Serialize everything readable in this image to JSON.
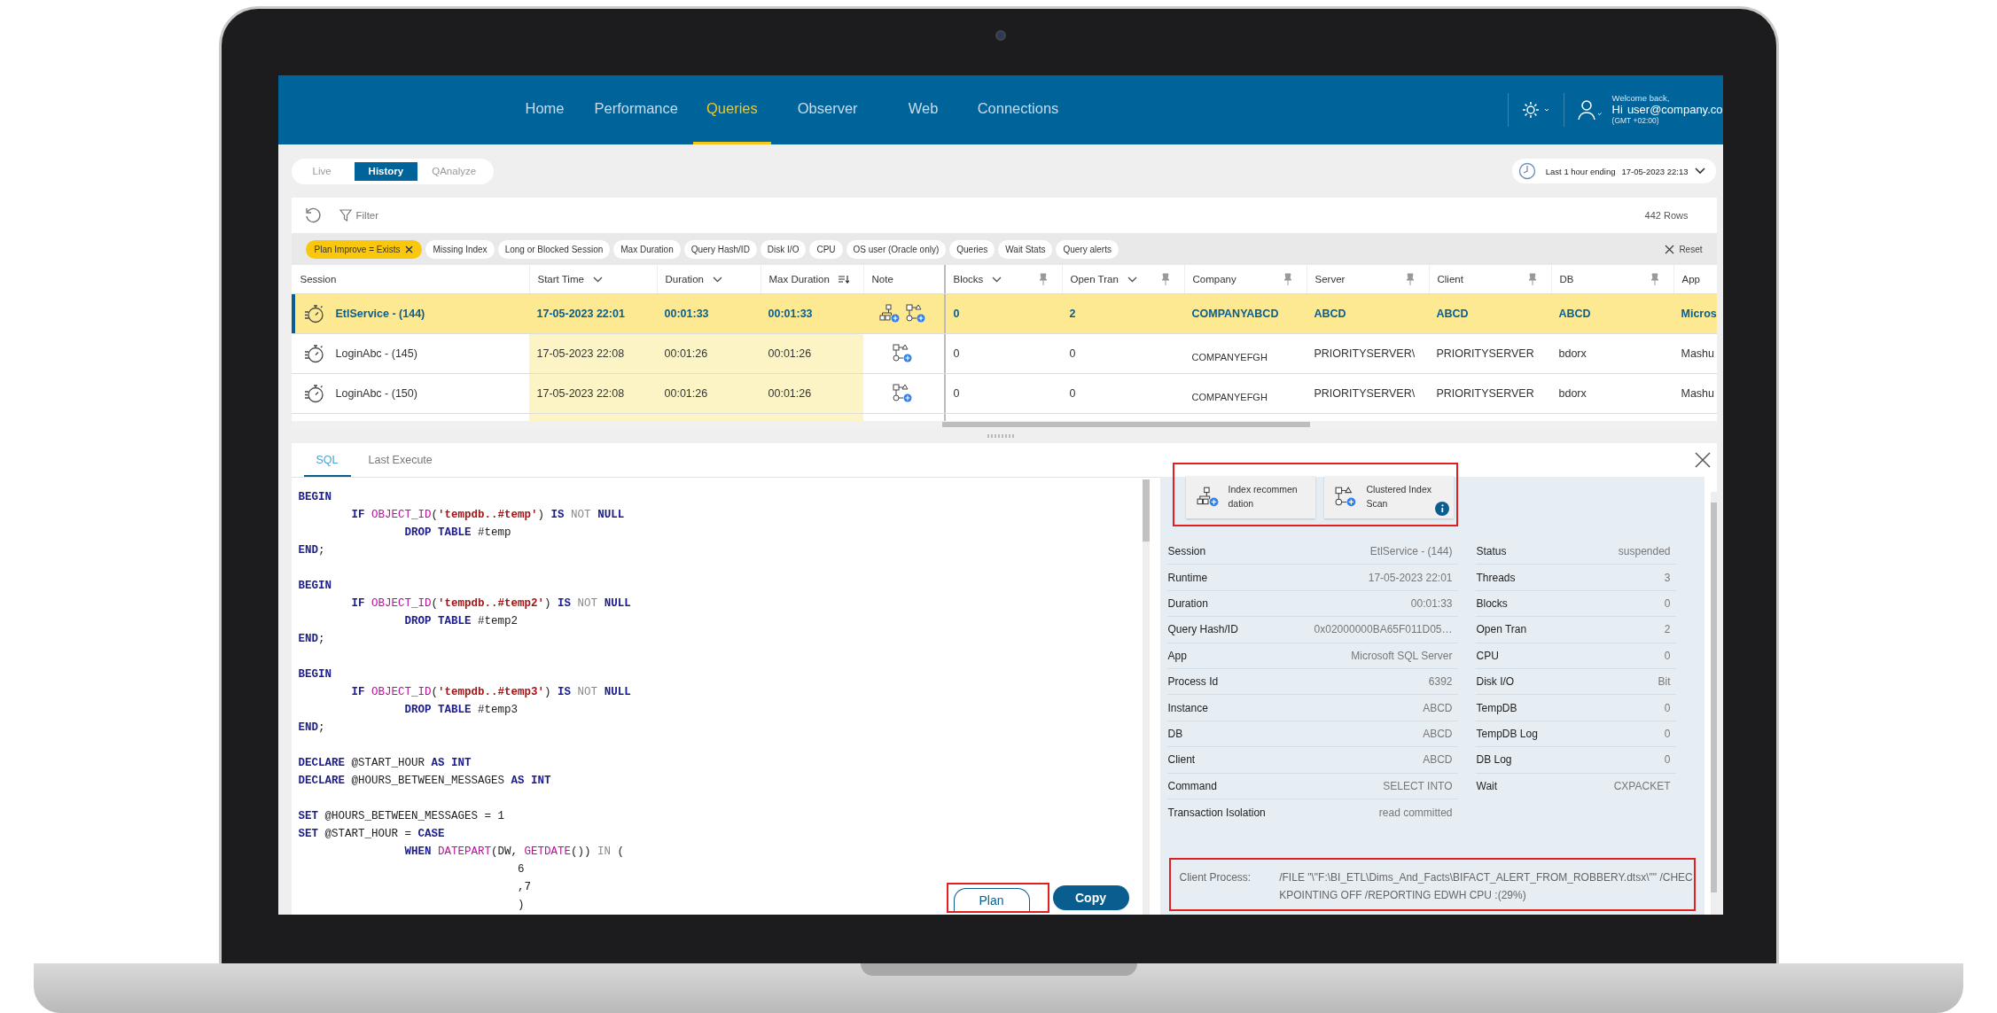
{
  "nav": {
    "items": [
      {
        "label": "Home",
        "selected": false
      },
      {
        "label": "Performance",
        "selected": false
      },
      {
        "label": "Queries",
        "selected": true
      },
      {
        "label": "Observer",
        "selected": false
      },
      {
        "label": "Web",
        "selected": false
      },
      {
        "label": "Connections",
        "selected": false
      }
    ],
    "welcome": "Welcome back,",
    "greeting": "Hi",
    "user": "user@company.co",
    "timezone": "(GMT +02:00)"
  },
  "mode_tabs": [
    {
      "label": "Live",
      "selected": false
    },
    {
      "label": "History",
      "selected": true
    },
    {
      "label": "QAnalyze",
      "selected": false
    }
  ],
  "time_range": {
    "label": "Last 1 hour ending",
    "value": "17-05-2023 22:13"
  },
  "toolbar": {
    "filter": "Filter",
    "row_count": "442 Rows",
    "reset": "Reset"
  },
  "chips": [
    {
      "label": "Plan Improve = Exists",
      "selected": true
    },
    {
      "label": "Missing Index",
      "selected": false
    },
    {
      "label": "Long or Blocked Session",
      "selected": false
    },
    {
      "label": "Max Duration",
      "selected": false
    },
    {
      "label": "Query Hash/ID",
      "selected": false
    },
    {
      "label": "Disk I/O",
      "selected": false
    },
    {
      "label": "CPU",
      "selected": false
    },
    {
      "label": "OS user (Oracle only)",
      "selected": false
    },
    {
      "label": "Queries",
      "selected": false
    },
    {
      "label": "Wait Stats",
      "selected": false
    },
    {
      "label": "Query alerts",
      "selected": false
    }
  ],
  "table": {
    "columns": [
      {
        "label": "Session",
        "menu": false,
        "sorted": false,
        "pinned": false,
        "highlighted": false
      },
      {
        "label": "Start Time",
        "menu": true,
        "sorted": false,
        "pinned": false,
        "highlighted": true
      },
      {
        "label": "Duration",
        "menu": true,
        "sorted": false,
        "pinned": false,
        "highlighted": true
      },
      {
        "label": "Max Duration",
        "menu": false,
        "sorted": true,
        "pinned": false,
        "highlighted": true
      },
      {
        "label": "Note",
        "menu": false,
        "sorted": false,
        "pinned": false,
        "highlighted": false
      },
      {
        "label": "Blocks",
        "menu": true,
        "sorted": false,
        "pinned": true,
        "highlighted": false
      },
      {
        "label": "Open Tran",
        "menu": true,
        "sorted": false,
        "pinned": true,
        "highlighted": false
      },
      {
        "label": "Company",
        "menu": false,
        "sorted": false,
        "pinned": true,
        "highlighted": false
      },
      {
        "label": "Server",
        "menu": false,
        "sorted": false,
        "pinned": true,
        "highlighted": false
      },
      {
        "label": "Client",
        "menu": false,
        "sorted": false,
        "pinned": true,
        "highlighted": false
      },
      {
        "label": "DB",
        "menu": false,
        "sorted": false,
        "pinned": true,
        "highlighted": false
      },
      {
        "label": "App",
        "menu": false,
        "sorted": false,
        "pinned": false,
        "highlighted": false
      }
    ],
    "rows": [
      {
        "selected": true,
        "notes": [
          {
            "kind": "index"
          },
          {
            "kind": "plan"
          }
        ],
        "cells": [
          "EtlService - (144)",
          "17-05-2023 22:01",
          "00:01:33",
          "00:01:33",
          "",
          "0",
          "2",
          "COMPANYABCD",
          "ABCD",
          "ABCD",
          "ABCD",
          "Micros"
        ]
      },
      {
        "selected": false,
        "notes": [
          {
            "kind": "plan"
          }
        ],
        "cells": [
          "LoginAbc - (145)",
          "17-05-2023 22:08",
          "00:01:26",
          "00:01:26",
          "",
          "0",
          "0",
          "COMPANYEFGH",
          "PRIORITYSERVER\\",
          "PRIORITYSERVER",
          "bdorx",
          "Mashu"
        ]
      },
      {
        "selected": false,
        "notes": [
          {
            "kind": "plan"
          }
        ],
        "cells": [
          "LoginAbc - (150)",
          "17-05-2023 22:08",
          "00:01:26",
          "00:01:26",
          "",
          "0",
          "0",
          "COMPANYEFGH",
          "PRIORITYSERVER\\",
          "PRIORITYSERVER",
          "bdorx",
          "Mashu"
        ]
      }
    ]
  },
  "sql_panel": {
    "tabs": [
      {
        "label": "SQL",
        "selected": true
      },
      {
        "label": "Last Execute",
        "selected": false
      }
    ],
    "blocks": [
      [
        [
          {
            "kind": "kw",
            "text": "BEGIN"
          }
        ],
        [
          {
            "kind": "kw",
            "text": "        IF "
          },
          {
            "kind": "fn",
            "text": "OBJECT_ID"
          },
          {
            "kind": "plain",
            "text": "("
          },
          {
            "kind": "str",
            "text": "'tempdb..#temp'"
          },
          {
            "kind": "plain",
            "text": ") "
          },
          {
            "kind": "kw",
            "text": "IS "
          },
          {
            "kind": "op",
            "text": "NOT "
          },
          {
            "kind": "kw",
            "text": "NULL"
          }
        ],
        [
          {
            "kind": "kw",
            "text": "                DROP TABLE "
          },
          {
            "kind": "plain",
            "text": "#temp"
          }
        ],
        [
          {
            "kind": "kw",
            "text": "END"
          },
          {
            "kind": "plain",
            "text": ";"
          }
        ]
      ],
      [
        [
          {
            "kind": "kw",
            "text": "BEGIN"
          }
        ],
        [
          {
            "kind": "kw",
            "text": "        IF "
          },
          {
            "kind": "fn",
            "text": "OBJECT_ID"
          },
          {
            "kind": "plain",
            "text": "("
          },
          {
            "kind": "str",
            "text": "'tempdb..#temp2'"
          },
          {
            "kind": "plain",
            "text": ") "
          },
          {
            "kind": "kw",
            "text": "IS "
          },
          {
            "kind": "op",
            "text": "NOT "
          },
          {
            "kind": "kw",
            "text": "NULL"
          }
        ],
        [
          {
            "kind": "kw",
            "text": "                DROP TABLE "
          },
          {
            "kind": "plain",
            "text": "#temp2"
          }
        ],
        [
          {
            "kind": "kw",
            "text": "END"
          },
          {
            "kind": "plain",
            "text": ";"
          }
        ]
      ],
      [
        [
          {
            "kind": "kw",
            "text": "BEGIN"
          }
        ],
        [
          {
            "kind": "kw",
            "text": "        IF "
          },
          {
            "kind": "fn",
            "text": "OBJECT_ID"
          },
          {
            "kind": "plain",
            "text": "("
          },
          {
            "kind": "str",
            "text": "'tempdb..#temp3'"
          },
          {
            "kind": "plain",
            "text": ") "
          },
          {
            "kind": "kw",
            "text": "IS "
          },
          {
            "kind": "op",
            "text": "NOT "
          },
          {
            "kind": "kw",
            "text": "NULL"
          }
        ],
        [
          {
            "kind": "kw",
            "text": "                DROP TABLE "
          },
          {
            "kind": "plain",
            "text": "#temp3"
          }
        ],
        [
          {
            "kind": "kw",
            "text": "END"
          },
          {
            "kind": "plain",
            "text": ";"
          }
        ]
      ],
      [
        [
          {
            "kind": "kw",
            "text": "DECLARE "
          },
          {
            "kind": "plain",
            "text": "@START_HOUR "
          },
          {
            "kind": "kw",
            "text": "AS INT"
          }
        ],
        [
          {
            "kind": "kw",
            "text": "DECLARE "
          },
          {
            "kind": "plain",
            "text": "@HOURS_BETWEEN_MESSAGES "
          },
          {
            "kind": "kw",
            "text": "AS INT"
          }
        ]
      ],
      [
        [
          {
            "kind": "kw",
            "text": "SET "
          },
          {
            "kind": "plain",
            "text": "@HOURS_BETWEEN_MESSAGES = 1"
          }
        ],
        [
          {
            "kind": "kw",
            "text": "SET "
          },
          {
            "kind": "plain",
            "text": "@START_HOUR = "
          },
          {
            "kind": "kw",
            "text": "CASE"
          }
        ],
        [
          {
            "kind": "kw",
            "text": "                WHEN "
          },
          {
            "kind": "fn",
            "text": "DATEPART"
          },
          {
            "kind": "plain",
            "text": "(DW, "
          },
          {
            "kind": "fn",
            "text": "GETDATE"
          },
          {
            "kind": "plain",
            "text": "()) "
          },
          {
            "kind": "op",
            "text": "IN "
          },
          {
            "kind": "plain",
            "text": "("
          }
        ],
        [
          {
            "kind": "plain",
            "text": "                                 6"
          }
        ],
        [
          {
            "kind": "plain",
            "text": "                                 ,7"
          }
        ],
        [
          {
            "kind": "plain",
            "text": "                                 )"
          }
        ]
      ]
    ],
    "buttons": [
      {
        "label": "Plan",
        "kind": "outline"
      },
      {
        "label": "Copy",
        "kind": "primary"
      }
    ]
  },
  "details": {
    "cards": [
      {
        "label": "Index recommendation",
        "kind": "index",
        "info": false
      },
      {
        "label": "Clustered Index Scan",
        "kind": "plan",
        "info": true
      }
    ],
    "left": [
      {
        "label": "Session",
        "value": "EtlService - (144)"
      },
      {
        "label": "Runtime",
        "value": "17-05-2023 22:01"
      },
      {
        "label": "Duration",
        "value": "00:01:33"
      },
      {
        "label": "Query Hash/ID",
        "value": "0x02000000BA65F011D05…"
      },
      {
        "label": "App",
        "value": "Microsoft SQL Server"
      },
      {
        "label": "Process Id",
        "value": "6392"
      },
      {
        "label": "Instance",
        "value": "ABCD"
      },
      {
        "label": "DB",
        "value": "ABCD"
      },
      {
        "label": "Client",
        "value": "ABCD"
      },
      {
        "label": "Command",
        "value": "SELECT INTO"
      },
      {
        "label": "Transaction Isolation",
        "value": "read committed"
      }
    ],
    "right": [
      {
        "label": "Status",
        "value": "suspended"
      },
      {
        "label": "Threads",
        "value": "3"
      },
      {
        "label": "Blocks",
        "value": "0"
      },
      {
        "label": "Open Tran",
        "value": "2"
      },
      {
        "label": "CPU",
        "value": "0"
      },
      {
        "label": "Disk I/O",
        "value": "Bit"
      },
      {
        "label": "TempDB",
        "value": "0"
      },
      {
        "label": "TempDB Log",
        "value": "0"
      },
      {
        "label": "DB Log",
        "value": "0"
      },
      {
        "label": "Wait",
        "value": "CXPACKET"
      }
    ],
    "client_process": {
      "label": "Client Process:",
      "value": "/FILE \"\\\"F:\\BI_ETL\\Dims_And_Facts\\BIFACT_ALERT_FROM_ROBBERY.dtsx\\\"\" /CHECKPOINTING OFF /REPORTING EDWH CPU :(29%)"
    }
  }
}
